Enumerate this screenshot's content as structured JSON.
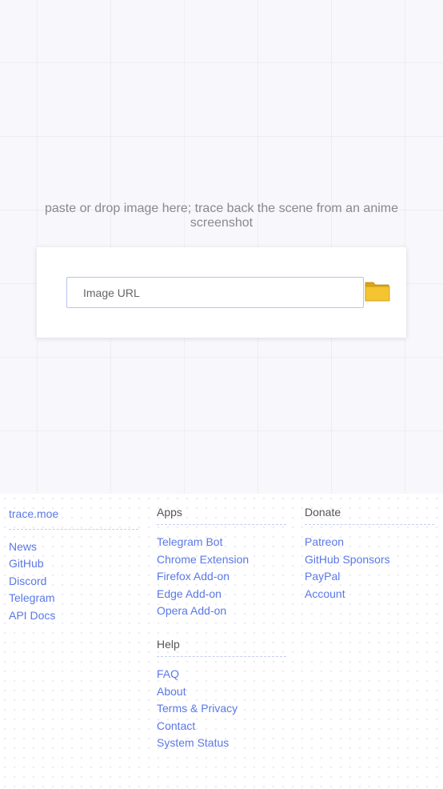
{
  "hero": {
    "tagline": "paste or drop image here; trace back the scene from an anime screenshot"
  },
  "search": {
    "placeholder": "Image URL",
    "value": "",
    "folder_icon": "folder-icon"
  },
  "colors": {
    "link": "#5a78e6",
    "folder": "#f2c233"
  },
  "footer": {
    "site": {
      "heading": "trace.moe",
      "links": [
        "News",
        "GitHub",
        "Discord",
        "Telegram",
        "API Docs"
      ]
    },
    "apps": {
      "heading": "Apps",
      "links": [
        "Telegram Bot",
        "Chrome Extension",
        "Firefox Add-on",
        "Edge Add-on",
        "Opera Add-on"
      ]
    },
    "donate": {
      "heading": "Donate",
      "links": [
        "Patreon",
        "GitHub Sponsors",
        "PayPal",
        "Account"
      ]
    },
    "help": {
      "heading": "Help",
      "links": [
        "FAQ",
        "About",
        "Terms & Privacy",
        "Contact",
        "System Status"
      ]
    }
  }
}
